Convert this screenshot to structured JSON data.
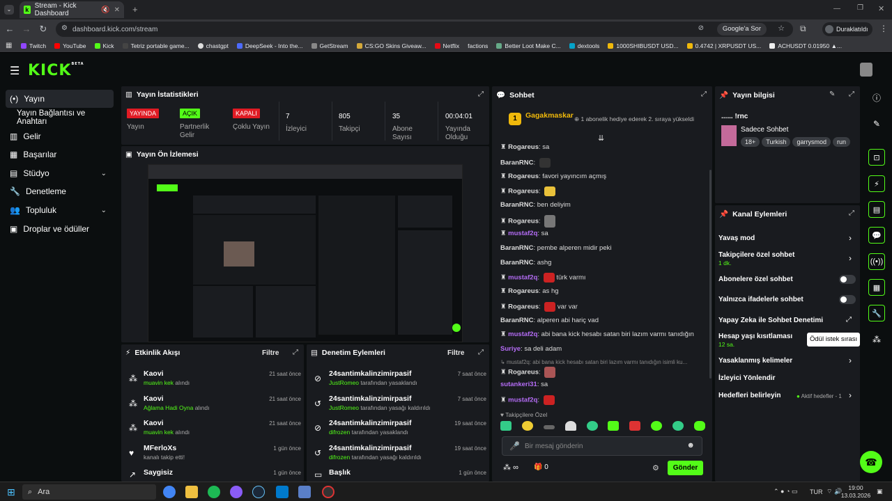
{
  "browser": {
    "tab_title": "Stream - Kick Dashboard",
    "url": "dashboard.kick.com/stream",
    "google_lens": "Google'a Sor",
    "profile": "Duraklatıldı",
    "bookmarks": [
      "Twitch",
      "YouTube",
      "Kick",
      "Tetriz portable game...",
      "chastgpt",
      "DeepSeek - Into the...",
      "GetStream",
      "CS:GO Skins Giveaw...",
      "Netflix",
      "factions",
      "Better Loot Make C...",
      "dextools",
      "1000SHIBUSDT USD...",
      "0.4742 | XRPUSDT US...",
      "ACHUSDT 0.01950 ▲..."
    ]
  },
  "kick": {
    "logo": "KICK",
    "beta": "BETA"
  },
  "sidebar": {
    "items": [
      {
        "label": "Yayın"
      },
      {
        "label": "Yayın Bağlantısı ve Anahtarı"
      },
      {
        "label": "Gelir"
      },
      {
        "label": "Başarılar"
      },
      {
        "label": "Stüdyo"
      },
      {
        "label": "Denetleme"
      },
      {
        "label": "Topluluk"
      },
      {
        "label": "Droplar ve ödüller"
      }
    ]
  },
  "stats": {
    "title": "Yayın İstatistikleri",
    "items": [
      {
        "badge": "YAYINDA",
        "badge_color": "#e01b24",
        "label": "Yayın"
      },
      {
        "badge": "AÇIK",
        "badge_color": "#53fc18",
        "label": "Partnerlik Gelir"
      },
      {
        "badge": "KAPALI",
        "badge_color": "#e01b24",
        "label": "Çoklu Yayın"
      },
      {
        "value": "7",
        "label": "İzleyici"
      },
      {
        "value": "805",
        "label": "Takipçi"
      },
      {
        "value": "35",
        "label": "Abone Sayısı"
      },
      {
        "value": "00:04:01",
        "label": "Yayında Olduğu"
      }
    ]
  },
  "preview": {
    "title": "Yayın Ön İzlemesi"
  },
  "activity": {
    "title": "Etkinlik Akışı",
    "filter": "Filtre",
    "rows": [
      {
        "name": "Kaovi",
        "highlight": "muavin kek",
        "text": " alındı",
        "time": "21 saat önce"
      },
      {
        "name": "Kaovi",
        "highlight": "Ağlama Hadi Oyna",
        "text": " alındı",
        "time": "21 saat önce"
      },
      {
        "name": "Kaovi",
        "highlight": "muavin kek",
        "text": " alındı",
        "time": "21 saat önce"
      },
      {
        "name": "MFerloXs",
        "highlight": "",
        "text": "kanalı takip etti!",
        "time": "1 gün önce"
      },
      {
        "name": "Saygisiz",
        "highlight": "",
        "text": "",
        "time": "1 gün önce"
      }
    ]
  },
  "moderation": {
    "title": "Denetim Eylemleri",
    "filter": "Filtre",
    "rows": [
      {
        "name": "24santimkalinzimirpasif",
        "highlight": "JustRomeo",
        "text": " tarafından yasaklandı",
        "time": "7 saat önce"
      },
      {
        "name": "24santimkalinzimirpasif",
        "highlight": "JustRomeo",
        "text": " tarafından yasağı kaldırıldı",
        "time": "7 saat önce"
      },
      {
        "name": "24santimkalinzimirpasif",
        "highlight": "difrozen",
        "text": " tarafından yasaklandı",
        "time": "19 saat önce"
      },
      {
        "name": "24santimkalinzimirpasif",
        "highlight": "difrozen",
        "text": " tarafından yasağı kaldırıldı",
        "time": "19 saat önce"
      },
      {
        "name": "Başlık",
        "highlight": "",
        "text": "",
        "time": "1 gün önce"
      }
    ]
  },
  "chat": {
    "title": "Sohbet",
    "pinned_user": "Gagakmaskar",
    "pinned_rank": "1",
    "pinned_text": "1 abonelik hediye ederek 2. sıraya yükseldi",
    "messages": [
      {
        "user": "Rogareus",
        "color": "#ffffff",
        "text": "sa"
      },
      {
        "user": "BaranRNC",
        "color": "#ffffff",
        "text": ""
      },
      {
        "user": "Rogareus",
        "color": "#ffffff",
        "text": "favori yayıncım açmış"
      },
      {
        "user": "Rogareus",
        "color": "#ffffff",
        "text": ""
      },
      {
        "user": "BaranRNC",
        "color": "#ffffff",
        "text": "ben deliyim"
      },
      {
        "user": "Rogareus",
        "color": "#ffffff",
        "text": ""
      },
      {
        "user": "mustaf2q",
        "color": "#b46cf5",
        "text": "sa"
      },
      {
        "user": "BaranRNC",
        "color": "#ffffff",
        "text": "pembe alperen midir peki"
      },
      {
        "user": "BaranRNC",
        "color": "#ffffff",
        "text": "ashg"
      },
      {
        "user": "mustaf2q",
        "color": "#b46cf5",
        "text": "türk varmı"
      },
      {
        "user": "Rogareus",
        "color": "#ffffff",
        "text": "as hg"
      },
      {
        "user": "Rogareus",
        "color": "#ffffff",
        "text": "var var"
      },
      {
        "user": "BaranRNC",
        "color": "#ffffff",
        "text": "alperen abi hariç vad"
      },
      {
        "user": "mustaf2q",
        "color": "#b46cf5",
        "text": "abi bana kick hesabı satan biri lazım varmı tanıdığın"
      },
      {
        "user": "Suriye",
        "color": "#b46cf5",
        "text": "sa deli adam"
      },
      {
        "user": "Rogareus",
        "color": "#ffffff",
        "text": ""
      },
      {
        "user": "sutankeri31",
        "color": "#b46cf5",
        "text": "sa"
      },
      {
        "user": "mustaf2q",
        "color": "#b46cf5",
        "text": ""
      }
    ],
    "reply_preview": "mustaf2q: abi bana kick hesabı satan biri lazım varmı tanıdığın isimli ku...",
    "followers_only": "Takipçilere Özel",
    "input_placeholder": "Bir mesaj gönderin",
    "points": "∞",
    "gift_count": "0",
    "send": "Gönder"
  },
  "stream_info": {
    "title": "Yayın bilgisi",
    "stream_title": "...... !rnc",
    "category": "Sadece Sohbet",
    "tags": [
      "18+",
      "Turkish",
      "garrysmod",
      "run"
    ]
  },
  "channel_actions": {
    "title": "Kanal Eylemleri",
    "items": [
      {
        "label": "Yavaş mod",
        "sub": ""
      },
      {
        "label": "Takipçilere özel sohbet",
        "sub": "1 dk."
      },
      {
        "label": "Abonelere özel sohbet",
        "sub": ""
      },
      {
        "label": "Yalnızca ifadelerle sohbet",
        "sub": ""
      },
      {
        "label": "Yapay Zeka ile Sohbet Denetimi",
        "sub": ""
      },
      {
        "label": "Hesap yaşı kısıtlaması",
        "sub": "12 sa."
      },
      {
        "label": "Yasaklanmış kelimeler",
        "sub": ""
      },
      {
        "label": "İzleyici Yönlendir",
        "sub": ""
      },
      {
        "label": "Hedefleri belirleyin",
        "sub": ""
      }
    ],
    "active_goals": "Aktif hedefler - 1",
    "tooltip": "Ödül istek sırası"
  },
  "taskbar": {
    "search": "Ara",
    "lang": "TUR",
    "time": "19:00",
    "date": "13.03.2026"
  }
}
